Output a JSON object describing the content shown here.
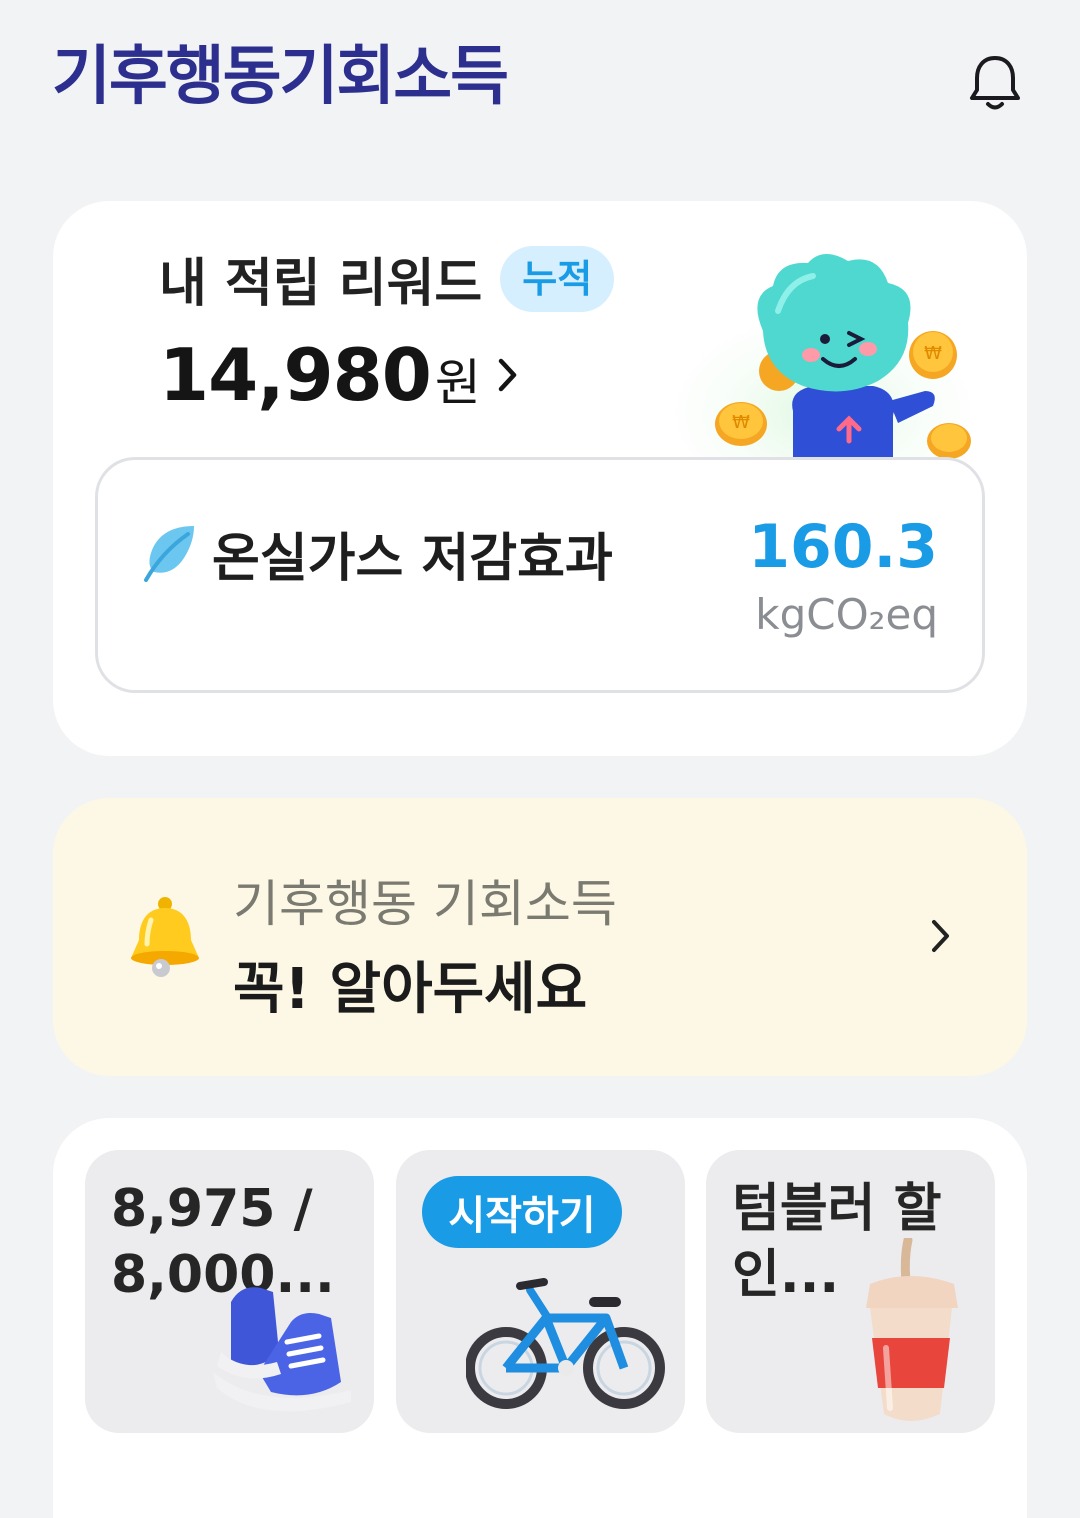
{
  "header": {
    "logo_text": "기후행동기회소득",
    "notification_icon": "bell-outline-icon"
  },
  "reward": {
    "title": "내 적립 리워드",
    "badge": "누적",
    "amount": "14,980",
    "currency": "원"
  },
  "ghg": {
    "label": "온실가스 저감효과",
    "value": "160.3",
    "unit": "kgCO₂eq",
    "icon": "leaf-icon"
  },
  "notice": {
    "subtitle": "기후행동 기회소득",
    "title": "꼭! 알아두세요",
    "icon": "bell-3d-icon"
  },
  "tiles": [
    {
      "text": "8,975 / 8,000...",
      "icon": "sneakers-icon"
    },
    {
      "button": "시작하기",
      "icon": "bicycle-icon"
    },
    {
      "text": "텀블러 할인...",
      "icon": "tumbler-icon"
    }
  ],
  "colors": {
    "brand": "#2d2f8f",
    "accent": "#1a9be6",
    "background": "#f1f3f5",
    "notice_bg": "#fdf8e6"
  }
}
